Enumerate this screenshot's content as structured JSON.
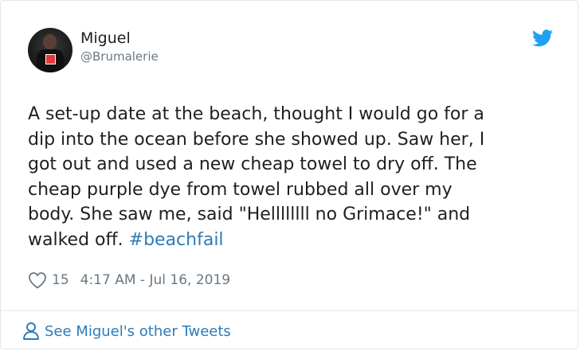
{
  "tweet": {
    "author_name": "Miguel",
    "author_handle": "@Brumalerie",
    "text_lines": [
      "A set-up date at the beach, thought I would go for a",
      "dip into the ocean before she showed up. Saw her, I",
      "got out and used a new cheap towel to dry off. The",
      "cheap purple dye from towel rubbed all over my",
      "body. She saw me, said \"Hellllllll no Grimace!\" and",
      "walked off. "
    ],
    "hashtag": "#beachfail",
    "likes": "15",
    "timestamp": "4:17 AM - Jul 16, 2019"
  },
  "footer": {
    "link_label": "See Miguel's other Tweets"
  },
  "icons": {
    "brand": "twitter-bird-icon",
    "like": "heart-outline-icon",
    "profile": "person-outline-icon"
  },
  "colors": {
    "twitter_blue": "#1da1f2",
    "link_blue": "#2b7bb9",
    "text": "#1c2022",
    "muted": "#697882",
    "border": "#e1e8ed"
  }
}
